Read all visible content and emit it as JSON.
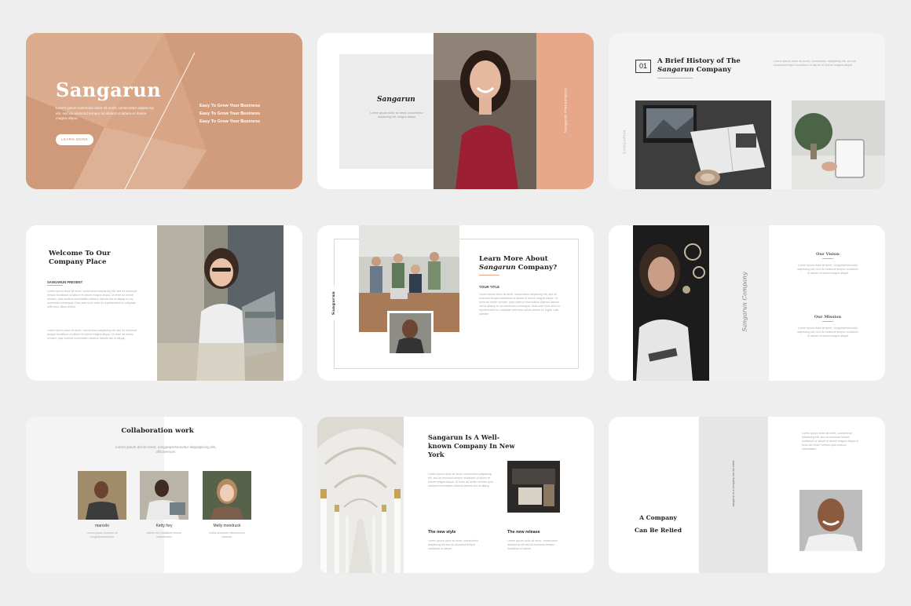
{
  "brand": "Sangarun",
  "slide1": {
    "title": "Sangarun",
    "body": "Lorem ipsum commodo dolor sit amet, consectetur adipiscing elit, sed do eiusmod tempor incididunt ut labore et dolore magna aliqua",
    "taglines": [
      "Easy To Grow Your Business",
      "Easy To Grow Your Business",
      "Easy To Grow Your Business"
    ],
    "button": "LEARN MORE",
    "accent": "#d9a687"
  },
  "slide2": {
    "title": "Sangarun",
    "body": "Lorem ipsum dolor sit amet, consectetur adipiscing elit, magna aliqua",
    "vertical": "Sangarun Presentation",
    "accent": "#e7a889"
  },
  "slide3": {
    "number": "01",
    "title_line1": "A Brief History of The",
    "title_em": "Sangarun",
    "title_line2_rest": " Company",
    "body": "Lorem ipsum dolor sit amet, consectetur adipiscing elit, sed do eiusmod tempor incididunt ut labore et dolore magna aliqua",
    "vertical": "SANGARUN"
  },
  "slide4": {
    "title": "Welcome To Our Company Place",
    "subtitle": "SANGARUN PRESENT",
    "para1": "Lorem ipsum dolor sit amet, consectetur adipiscing elit, sed do eiusmod tempor incididunt ut labore et dolore magna aliqua. Ut enim ad minim veniam, quis nostrud exercitation ullamco laboris nisi ut aliquip ex ea commodo consequat. Duis aute irure dolor in reprehenderit in voluptate velit esse cillum dolore",
    "para2": "Lorem ipsum dolor sit amet, consectetur adipiscing elit, sed do eiusmod tempor incididunt ut labore et dolore magna aliqua. Ut enim ad minim veniam, quis nostrud exercitation ullamco laboris nisi ut aliquip"
  },
  "slide5": {
    "title_line1": "Learn More About",
    "title_em": "Sangarun",
    "title_line2_rest": " Company?",
    "label": "YOUR TITLE",
    "body": "Lorem ipsum dolor sit amet, consectetur adipiscing elit, sed do eiusmod tempor incididunt ut labore et dolore magna aliqua. Ut enim ad minim veniam, quis nostrud exercitation ullamco laboris nisi ut aliquip ex ea commodo consequat. Duis aute irure dolor in reprehenderit in voluptate velit esse cillum dolore eu fugiat nulla pariatur",
    "vertical": "Sangarun"
  },
  "slide6": {
    "vertical": "Sangarun Company",
    "vision_title": "Our Vision",
    "vision_body": "Lorem ipsum dolor sit amet, congueperseucetur adipiscing elit, sed do eiusmod tempor incididunt ut labore et dolore magna aliqua",
    "mission_title": "Our Mission",
    "mission_body": "Lorem ipsum dolor sit amet, congueperseucetur adipiscing elit, sed do eiusmod tempor incididunt ut labore et dolore magna aliqua"
  },
  "slide7": {
    "title": "Collaboration work",
    "subtitle": "Lorem ipsum dol sit amet, congueperseucetur aliqualpicing elit, officiorenom",
    "people": [
      {
        "name": "marcelo",
        "desc": "Lorem ipsum dolorem sit congueperseucetur"
      },
      {
        "name": "Ketty fory",
        "desc": "sedem eiu incididunt tempor incididuntem"
      },
      {
        "name": "Melly mondruck",
        "desc": "cullus auctorem officiorenom deseum"
      }
    ]
  },
  "slide8": {
    "title": "Sangarun Is A Well-known Company In New York",
    "body": "Lorem ipsum dolor sit amet, consectetur adipiscing elit, sed do eiusmod tempor incididunt ut labore et dolore magna aliqua. Ut enim ad minim veniam quis nostrud exercitation ullamco laboris nisi ut aliquip",
    "col1_title": "The new style",
    "col1_body": "Lorem ipsum dolor sit amet, consectetur adipiscing elit sed do eiusmod tempor incididunt ut labore",
    "col2_title": "The new release",
    "col2_body": "Lorem ipsum dolor sit amet, consectetur adipiscing elit sed do eiusmod tempor incididunt ut labore"
  },
  "slide9": {
    "title_line1": "A Company",
    "title_line2": "Can Be Relied",
    "vertical": "sangarun is a company can be relied",
    "body": "Lorem ipsum dolor sit amet, consectetur adipiscing elit, sed do eiusmod tempor incididunt ut labore et dolore magna aliqua ut enim ad minim veniam quis nostrud exercitation"
  }
}
